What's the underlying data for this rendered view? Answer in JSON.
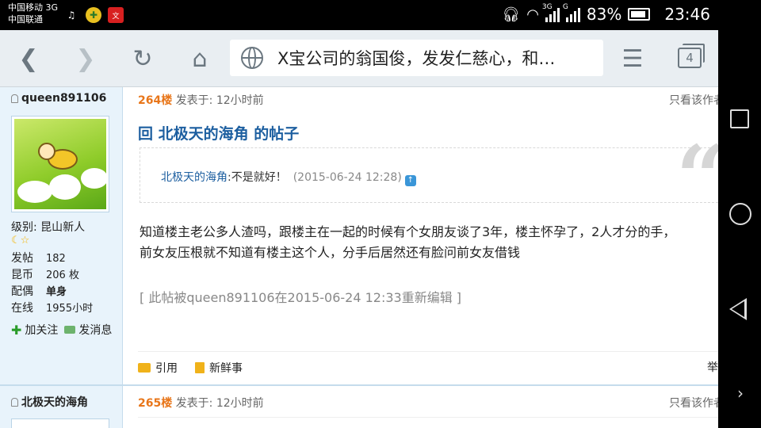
{
  "status_bar": {
    "carrier_line1": "中国移动 3G",
    "carrier_line2": "中国联通",
    "net_tag1": "3G",
    "net_tag2": "G",
    "battery": "83%",
    "time": "23:46"
  },
  "toolbar": {
    "url_title": "X宝公司的翁国俊，发发仁慈心，和…",
    "tab_count": "4"
  },
  "post1": {
    "user": {
      "name": "queen891106",
      "rank_label": "级别:",
      "rank_value": "昆山新人",
      "stats": [
        {
          "k": "发帖",
          "v": "182"
        },
        {
          "k": "昆币",
          "v": "206 枚"
        },
        {
          "k": "配偶",
          "v": "单身"
        },
        {
          "k": "在线",
          "v": "1955小时"
        }
      ],
      "follow_label": "加关注",
      "message_label": "发消息"
    },
    "floor": "264楼",
    "posted": "发表于: 12小时前",
    "only_author": "只看该作者",
    "title": "回 北极天的海角 的帖子",
    "quote": {
      "name": "北极天的海角",
      "text": ":不是就好！",
      "date": "(2015-06-24 12:28)"
    },
    "body_line1": "知道楼主老公多人渣吗，跟楼主在一起的时候有个女朋友谈了3年，楼主怀孕了，2人才分的手，",
    "body_line2": "前女友压根就不知道有楼主这个人，分手后居然还有脸问前女友借钱",
    "edit_note": "[ 此帖被queen891106在2015-06-24 12:33重新编辑 ]",
    "footer": {
      "quote_label": "引用",
      "news_label": "新鲜事",
      "report_label": "举报"
    }
  },
  "post2": {
    "user_name": "北极天的海角",
    "floor": "265楼",
    "posted": "发表于: 12小时前",
    "only_author": "只看该作者"
  }
}
